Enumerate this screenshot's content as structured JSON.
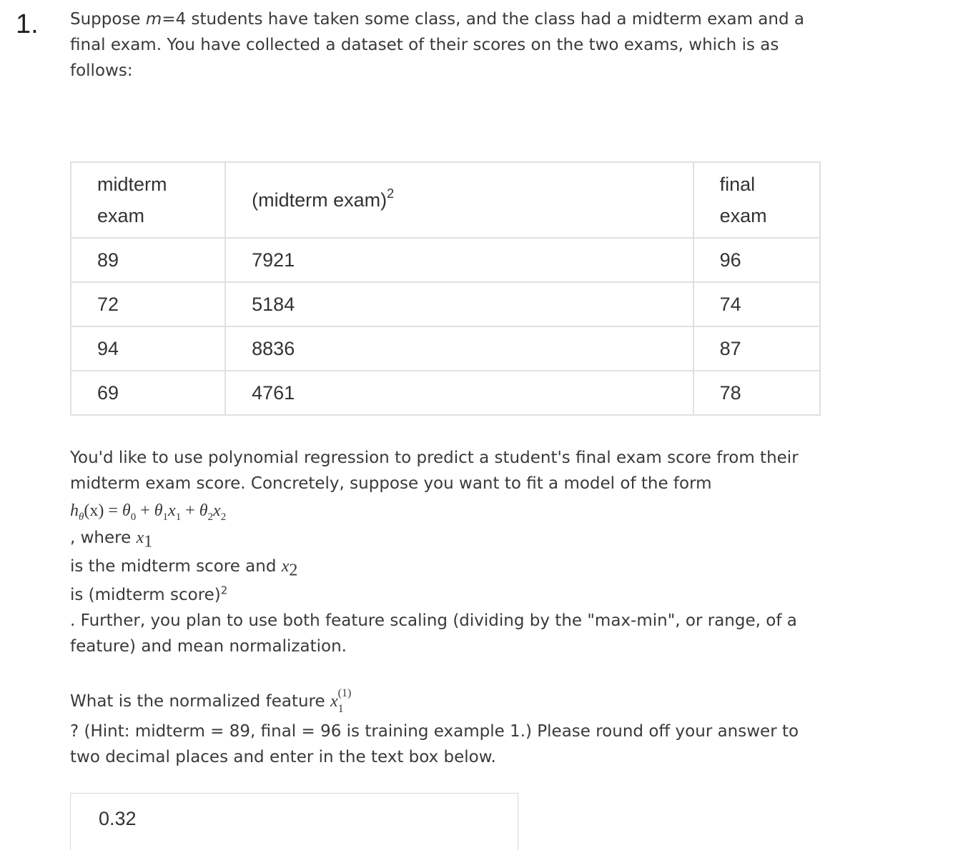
{
  "question": {
    "number": "1.",
    "intro_pre": "Suppose ",
    "intro_m": "m",
    "intro_post": "=4 students have taken some class, and the class had a midterm exam and a final exam. You have collected a dataset of their scores on the two exams, which is as follows:"
  },
  "table": {
    "headers": {
      "col1_line1": "midterm",
      "col1_line2": "exam",
      "col2": "(midterm exam)",
      "col2_sup": "2",
      "col3_line1": "final",
      "col3_line2": "exam"
    },
    "rows": [
      [
        "89",
        "7921",
        "96"
      ],
      [
        "72",
        "5184",
        "74"
      ],
      [
        "94",
        "8836",
        "87"
      ],
      [
        "69",
        "4761",
        "78"
      ]
    ]
  },
  "paragraph2": {
    "line1": "You'd like to use polynomial regression to predict a student's final exam score from their midterm exam score. Concretely, suppose you want to fit a model of the form",
    "formula": {
      "lhs": "h",
      "lhs_sub": "θ",
      "arg": "(x) = ",
      "t0": "θ",
      "t0_sub": "0",
      "plus1": " + ",
      "t1": "θ",
      "t1_sub": "1",
      "x1": "x",
      "x1_sub": "1",
      "plus2": " + ",
      "t2": "θ",
      "t2_sub": "2",
      "x2": "x",
      "x2_sub": "2"
    },
    "where_text": ", where ",
    "where_var": "x",
    "where_sub": "1",
    "midterm_text": "is the midterm score and ",
    "midterm_var": "x",
    "midterm_sub": "2",
    "square_text": "is (midterm score)",
    "square_sup": "2",
    "further_text": ". Further, you plan to use both feature scaling (dividing by the \"max-min\", or range, of a feature) and mean normalization."
  },
  "paragraph3": {
    "question_text": "What is the normalized feature ",
    "var": "x",
    "var_sup": "(1)",
    "var_sub": "1",
    "hint": "? (Hint: midterm = 89, final = 96 is training example 1.) Please round off your answer to two decimal places and enter in the text box below."
  },
  "answer": {
    "value": "0.32"
  }
}
